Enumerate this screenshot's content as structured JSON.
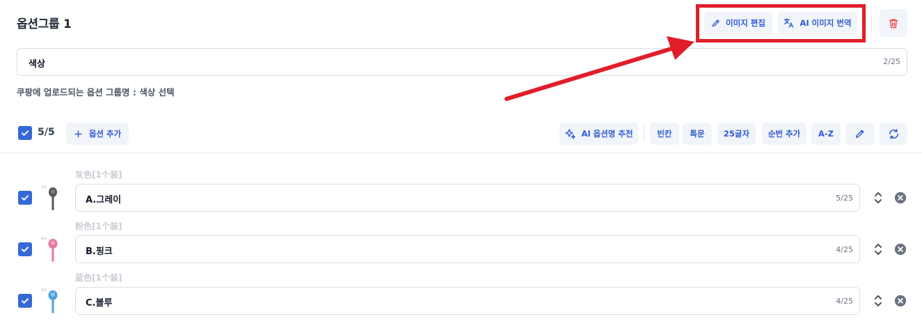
{
  "group": {
    "title": "옵션그룹 1",
    "name_value": "색상",
    "name_count": "2/25",
    "upload_note": "쿠팡에 업로드되는 옵션 그룹명 : 색상 선택"
  },
  "header_actions": {
    "edit_image_label": "이미지 편집",
    "ai_translate_label": "AI 이미지 번역"
  },
  "toolbar": {
    "selected_count": "5/5",
    "add_option_label": "옵션 추가",
    "ai_recommend_label": "AI 옵션명 추천",
    "blank_label": "빈칸",
    "special_label": "특문",
    "chars_label": "25글자",
    "serial_label": "순번 추가",
    "az_label": "A-Z"
  },
  "options": [
    {
      "original": "灰色[1个装]",
      "value": "A.그레이",
      "count": "5/25",
      "checked": true,
      "color": "#55575c"
    },
    {
      "original": "粉色[1个装]",
      "value": "B.핑크",
      "count": "4/25",
      "checked": true,
      "color": "#e8779a"
    },
    {
      "original": "蓝色[1个装]",
      "value": "C.블루",
      "count": "4/25",
      "checked": true,
      "color": "#4da3dd"
    }
  ],
  "colors": {
    "accent": "#2f5bd3",
    "checkbox": "#3569d6",
    "delete": "#ef4444",
    "annotation": "#e11d2a"
  }
}
